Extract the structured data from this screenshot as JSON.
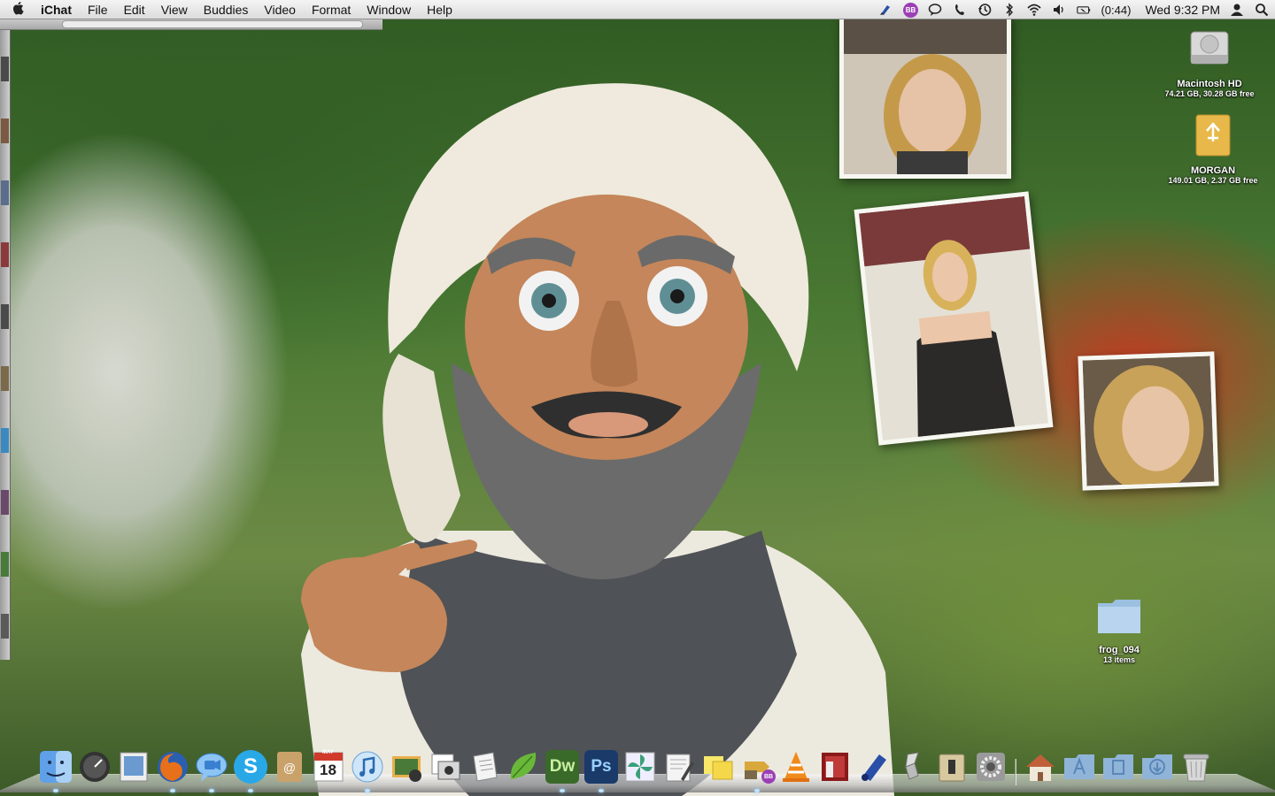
{
  "menubar": {
    "app_name": "iChat",
    "menus": [
      "File",
      "Edit",
      "View",
      "Buddies",
      "Video",
      "Format",
      "Window",
      "Help"
    ],
    "status_icons": [
      "script-icon",
      "bb-badge-icon",
      "speech-bubble-icon",
      "phone-icon",
      "time-machine-icon",
      "bluetooth-icon",
      "wifi-icon",
      "volume-icon",
      "battery-icon",
      "user-icon",
      "spotlight-icon"
    ],
    "bb_badge": "BB",
    "battery_time": "(0:44)",
    "clock": "Wed 9:32 PM"
  },
  "desktop": {
    "icons": [
      {
        "label": "Macintosh HD",
        "sub": "74.21 GB, 30.28 GB free",
        "icon": "hard-drive-icon"
      },
      {
        "label": "MORGAN",
        "sub": "149.01 GB, 2.37 GB free",
        "icon": "usb-drive-icon"
      },
      {
        "label": "frog_094",
        "sub": "13 items",
        "icon": "folder-icon"
      }
    ],
    "photos": [
      "photo-widget",
      "photo-widget",
      "photo-widget"
    ]
  },
  "dock": {
    "items": [
      "Finder",
      "Dashboard",
      "Preview",
      "Firefox",
      "iChat",
      "Skype",
      "Address Book",
      "iCal",
      "iTunes",
      "iPhoto",
      "Image Capture",
      "TextEdit",
      "Growl",
      "Dreamweaver",
      "Photoshop",
      "Pinwheel",
      "Script Editor",
      "Stickies",
      "Boot Camp",
      "VLC",
      "Photo Booth",
      "Xcode",
      "Flashlight",
      "Dictionary",
      "System Preferences",
      "Home",
      "Applications",
      "Documents",
      "Downloads",
      "Trash"
    ],
    "ical_date": "18",
    "ical_month": "MAY",
    "dreamweaver": "Dw",
    "photoshop": "Ps",
    "skype": "S",
    "boot_badge": "BB"
  },
  "colors": {
    "menubar_bg": "#e8e8e8",
    "wallpaper_green": "#3f6a2e",
    "accent_blue": "#3a80d0"
  }
}
